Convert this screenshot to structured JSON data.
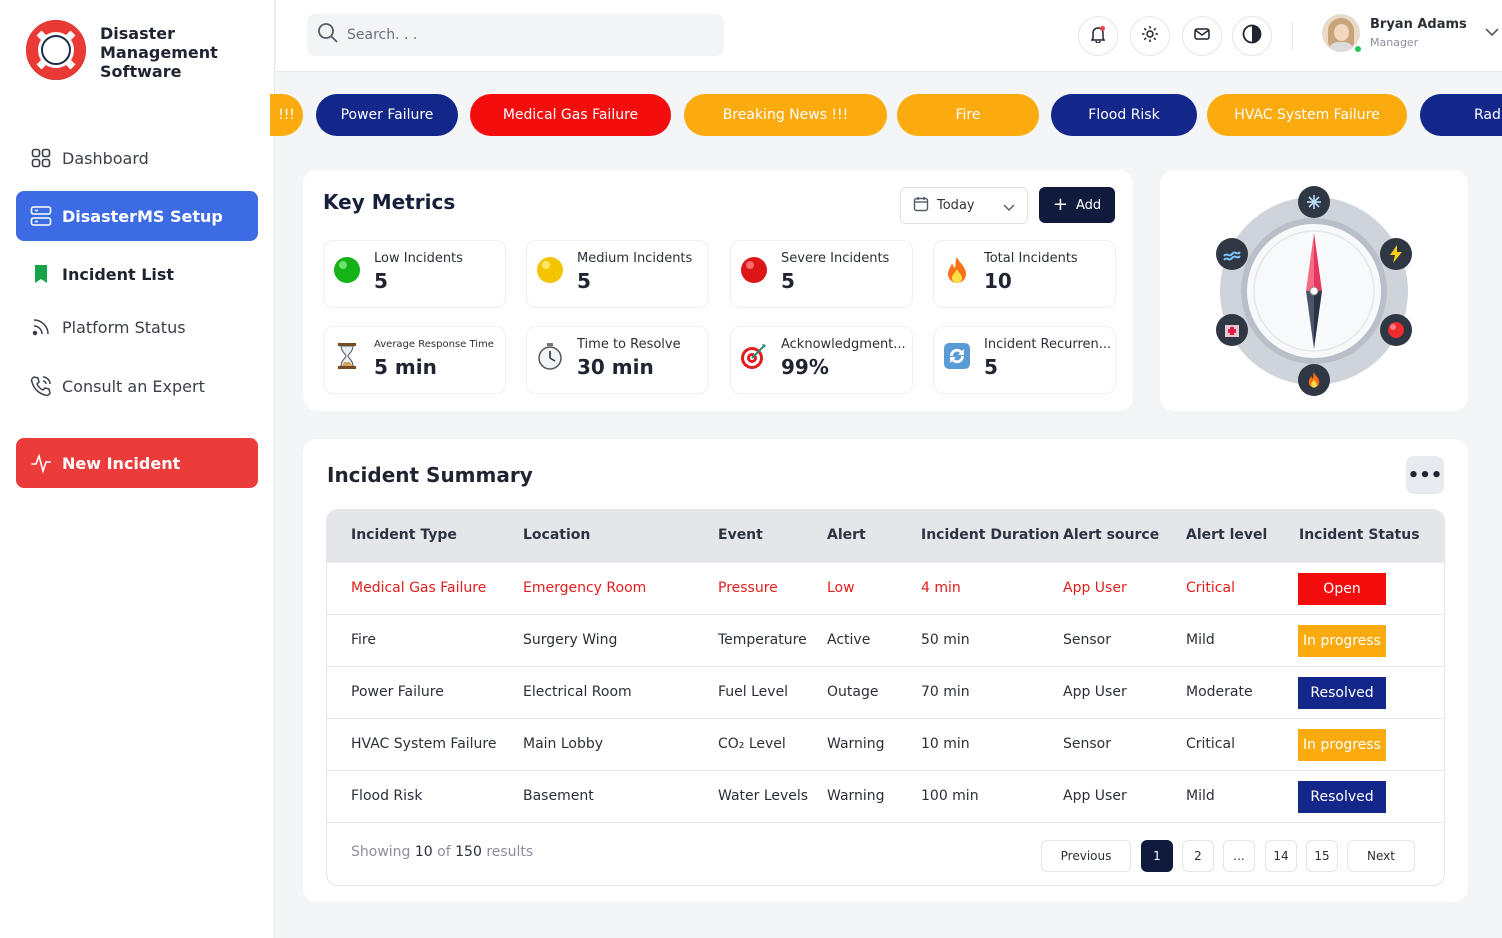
{
  "app": {
    "title_line1": "Disaster",
    "title_line2": "Management",
    "title_line3": "Software"
  },
  "sidebar": {
    "items": [
      {
        "label": "Dashboard",
        "icon": "grid-icon"
      },
      {
        "label": "DisasterMS Setup",
        "icon": "server-icon"
      },
      {
        "label": "Incident List",
        "icon": "bookmark-icon"
      },
      {
        "label": "Platform Status",
        "icon": "rss-icon"
      },
      {
        "label": "Consult an Expert",
        "icon": "phone-icon"
      }
    ],
    "new_incident": "New Incident"
  },
  "header": {
    "search_placeholder": "Search. . .",
    "user_name": "Bryan Adams",
    "user_role": "Manager"
  },
  "ticker": [
    {
      "label": "!!!",
      "color": "orange"
    },
    {
      "label": "Power Failure",
      "color": "navy"
    },
    {
      "label": "Medical Gas Failure",
      "color": "red"
    },
    {
      "label": "Breaking News !!!",
      "color": "orange"
    },
    {
      "label": "Fire",
      "color": "orange"
    },
    {
      "label": "Flood Risk",
      "color": "navy"
    },
    {
      "label": "HVAC System Failure",
      "color": "orange"
    },
    {
      "label": "Radi",
      "color": "navy"
    }
  ],
  "key_metrics": {
    "title": "Key Metrics",
    "date_filter": "Today",
    "add_label": "Add",
    "metrics": [
      {
        "label": "Low Incidents",
        "value": "5",
        "icon": "green-dot-icon"
      },
      {
        "label": "Medium Incidents",
        "value": "5",
        "icon": "yellow-dot-icon"
      },
      {
        "label": "Severe Incidents",
        "value": "5",
        "icon": "red-dot-icon"
      },
      {
        "label": "Total Incidents",
        "value": "10",
        "icon": "flame-icon"
      },
      {
        "label": "Average Response Time",
        "value": "5 min",
        "icon": "hourglass-icon"
      },
      {
        "label": "Time to Resolve",
        "value": "30 min",
        "icon": "stopwatch-icon"
      },
      {
        "label": "Acknowledgment...",
        "value": "99%",
        "icon": "target-icon"
      },
      {
        "label": "Incident Recurren...",
        "value": "5",
        "icon": "recycle-icon"
      }
    ]
  },
  "summary": {
    "title": "Incident Summary",
    "columns": [
      "Incident Type",
      "Location",
      "Event",
      "Alert",
      "Incident Duration",
      "Alert source",
      "Alert level",
      "Incident Status"
    ],
    "rows": [
      {
        "type": "Medical Gas Failure",
        "location": "Emergency Room",
        "event": "Pressure",
        "alert": "Low",
        "duration": "4 min",
        "source": "App User",
        "level": "Critical",
        "status": "Open"
      },
      {
        "type": "Fire",
        "location": "Surgery Wing",
        "event": "Temperature",
        "alert": "Active",
        "duration": "50 min",
        "source": "Sensor",
        "level": "Mild",
        "status": "In progress"
      },
      {
        "type": "Power Failure",
        "location": "Electrical Room",
        "event": "Fuel Level",
        "alert": "Outage",
        "duration": "70 min",
        "source": "App User",
        "level": "Moderate",
        "status": "Resolved"
      },
      {
        "type": "HVAC System Failure",
        "location": "Main Lobby",
        "event": "CO₂ Level",
        "alert": "Warning",
        "duration": "10 min",
        "source": "Sensor",
        "level": "Critical",
        "status": "In progress"
      },
      {
        "type": "Flood Risk",
        "location": "Basement",
        "event": "Water Levels",
        "alert": "Warning",
        "duration": "100 min",
        "source": "App User",
        "level": "Mild",
        "status": "Resolved"
      }
    ],
    "showing_prefix": "Showing",
    "showing_count": "10",
    "showing_of": "of",
    "showing_total": "150",
    "showing_suffix": "results",
    "pagination": {
      "previous": "Previous",
      "pages": [
        "1",
        "2",
        "...",
        "14",
        "15"
      ],
      "next": "Next"
    }
  },
  "colors": {
    "primary": "#3d6be3",
    "danger": "#ec3b3b",
    "navy": "#13268a",
    "orange": "#fcab0f",
    "red": "#f40d0d"
  }
}
